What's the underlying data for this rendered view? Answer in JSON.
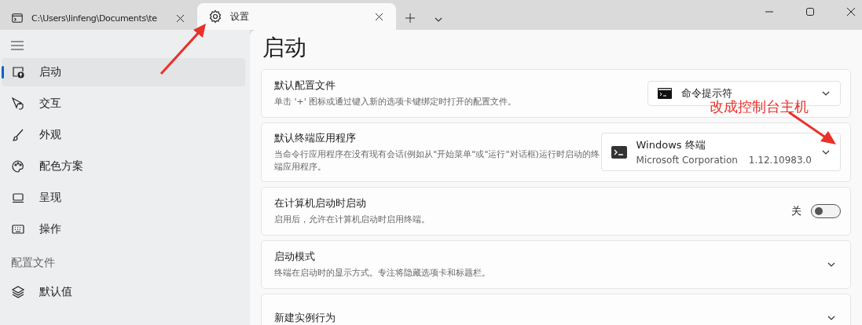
{
  "tabs": [
    {
      "label": "C:\\Users\\linfeng\\Documents\\te",
      "kind": "console",
      "selected": false
    },
    {
      "label": "设置",
      "kind": "settings",
      "selected": true
    }
  ],
  "sidebar": {
    "items": [
      {
        "label": "启动",
        "selected": true
      },
      {
        "label": "交互",
        "selected": false
      },
      {
        "label": "外观",
        "selected": false
      },
      {
        "label": "配色方案",
        "selected": false
      },
      {
        "label": "呈现",
        "selected": false
      },
      {
        "label": "操作",
        "selected": false
      }
    ],
    "section_header": "配置文件",
    "profiles": [
      {
        "label": "默认值",
        "selected": false
      }
    ]
  },
  "page_title": "启动",
  "settings": [
    {
      "kind": "dropdown",
      "title": "默认配置文件",
      "description": "单击 '+' 图标或通过键入新的选项卡键绑定时打开的配置文件。",
      "value": "命令提示符"
    },
    {
      "kind": "dropdown",
      "title": "默认终端应用程序",
      "description": "当命令行应用程序在没有现有会话(例如从\"开始菜单\"或\"运行\"对话框)运行时启动的终端应用程序。",
      "value": "Windows 终端",
      "publisher": "Microsoft Corporation",
      "version": "1.12.10983.0"
    },
    {
      "kind": "toggle",
      "title": "在计算机启动时启动",
      "description": "启用后，允许在计算机启动时启用终端。",
      "state_label": "关",
      "on": false
    },
    {
      "kind": "expander",
      "title": "启动模式",
      "description": "终端在启动时的显示方式。专注将隐藏选项卡和标题栏。"
    },
    {
      "kind": "expander",
      "title": "新建实例行为"
    }
  ],
  "annotation": {
    "text": "改成控制台主机"
  }
}
